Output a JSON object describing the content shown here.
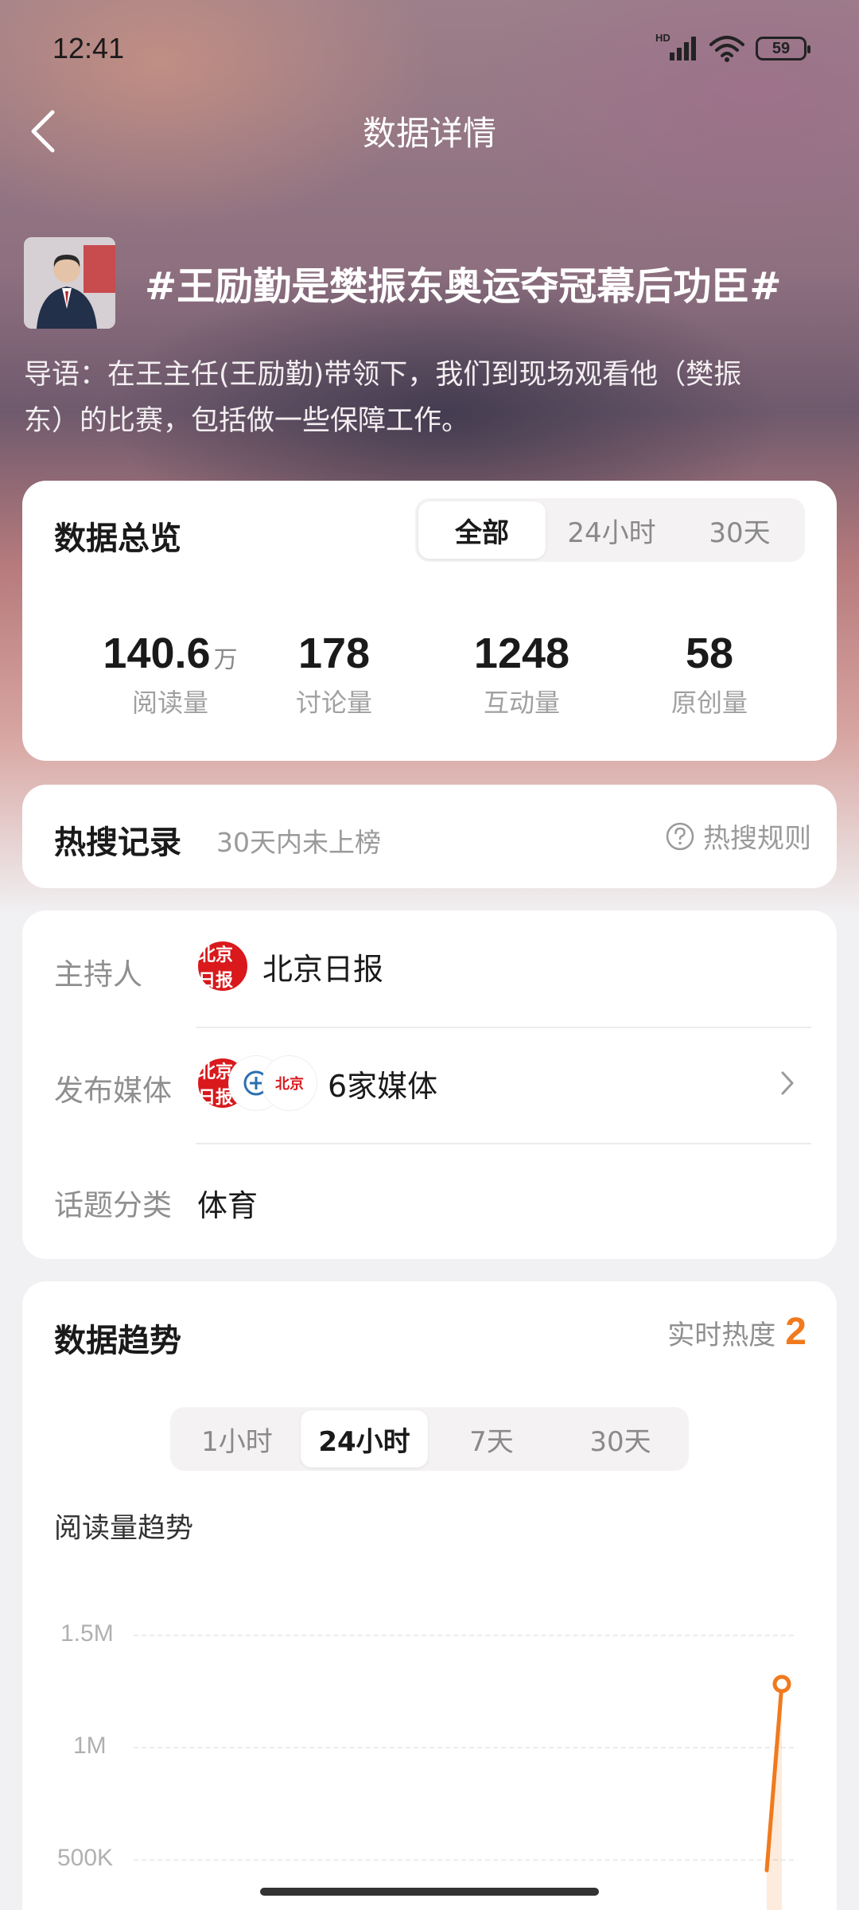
{
  "status_bar": {
    "time": "12:41",
    "battery": "59",
    "signal_tag": "HD"
  },
  "nav": {
    "title": "数据详情",
    "back_icon": "chevron-left-icon"
  },
  "topic": {
    "title": "#王励勤是樊振东奥运夺冠幕后功臣#",
    "intro_line1": "导语：在王主任(王励勤)带领下，我们到现场观看他（樊振",
    "intro_line2": "东）的比赛，包括做一些保障工作。"
  },
  "overview": {
    "title": "数据总览",
    "tabs": [
      {
        "label": "全部",
        "active": true
      },
      {
        "label": "24小时",
        "active": false
      },
      {
        "label": "30天",
        "active": false
      }
    ],
    "stats": [
      {
        "value": "140.6",
        "unit": "万",
        "label": "阅读量"
      },
      {
        "value": "178",
        "unit": "",
        "label": "讨论量"
      },
      {
        "value": "1248",
        "unit": "",
        "label": "互动量"
      },
      {
        "value": "58",
        "unit": "",
        "label": "原创量"
      }
    ]
  },
  "hot_search": {
    "title": "热搜记录",
    "note": "30天内未上榜",
    "rules_label": "热搜规则"
  },
  "info": {
    "host_label": "主持人",
    "host_value": "北京日报",
    "media_label": "发布媒体",
    "media_value": "6家媒体",
    "category_label": "话题分类",
    "category_value": "体育"
  },
  "trend": {
    "title": "数据趋势",
    "realtime_label": "实时热度",
    "realtime_value": "2",
    "tabs": [
      {
        "label": "1小时",
        "active": false
      },
      {
        "label": "24小时",
        "active": true
      },
      {
        "label": "7天",
        "active": false
      },
      {
        "label": "30天",
        "active": false
      }
    ],
    "chart_title": "阅读量趋势"
  },
  "chart_data": {
    "type": "line",
    "title": "阅读量趋势",
    "y_ticks": [
      "1.5M",
      "1M",
      "500K"
    ],
    "ylim": [
      0,
      1500000
    ],
    "series": [
      {
        "values": [
          450000,
          1280000
        ]
      }
    ],
    "color": "#f07a1e",
    "grid": true
  },
  "colors": {
    "accent": "#f07a1e",
    "brand_red": "#d9191c"
  }
}
